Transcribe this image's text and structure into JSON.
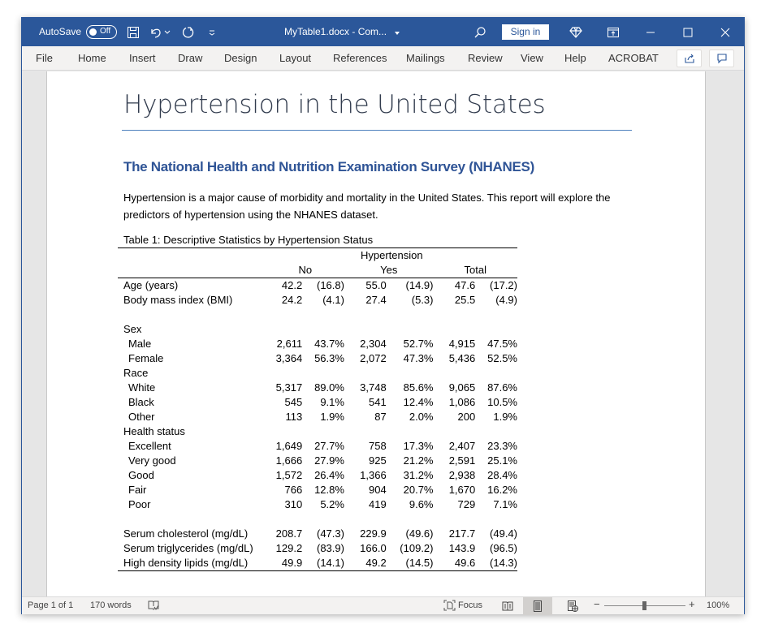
{
  "titlebar": {
    "autosave_label": "AutoSave",
    "autosave_state": "Off",
    "document_title": "MyTable1.docx  -  Com...",
    "sign_in_label": "Sign in",
    "icons": [
      "save-icon",
      "undo-icon",
      "redo-icon",
      "customize-qat-icon",
      "search-icon",
      "premium-diamond-icon",
      "ribbon-display-icon",
      "minimize-icon",
      "maximize-icon",
      "close-icon"
    ]
  },
  "ribbon": {
    "tabs": [
      "File",
      "Home",
      "Insert",
      "Draw",
      "Design",
      "Layout",
      "References",
      "Mailings",
      "Review",
      "View",
      "Help",
      "ACROBAT"
    ]
  },
  "document": {
    "title": "Hypertension in the United States",
    "subtitle": "The National Health and Nutrition Examination Survey (NHANES)",
    "paragraph": "Hypertension is a major cause of morbidity and mortality in the United States.  This report will explore the predictors of hypertension using the NHANES dataset.",
    "table": {
      "caption": "Table 1: Descriptive Statistics by Hypertension Status",
      "spanner": "Hypertension",
      "groups": [
        "No",
        "Yes",
        "Total"
      ],
      "rows": [
        {
          "label": "Age (years)",
          "indent": false,
          "values": [
            "42.2",
            "(16.8)",
            "55.0",
            "(14.9)",
            "47.6",
            "(17.2)"
          ]
        },
        {
          "label": "Body mass index (BMI)",
          "indent": false,
          "values": [
            "24.2",
            "(4.1)",
            "27.4",
            "(5.3)",
            "25.5",
            "(4.9)"
          ]
        },
        {
          "label": "",
          "indent": false,
          "values": [
            "",
            "",
            "",
            "",
            "",
            ""
          ]
        },
        {
          "label": "Sex",
          "indent": false,
          "values": [
            "",
            "",
            "",
            "",
            "",
            ""
          ]
        },
        {
          "label": "Male",
          "indent": true,
          "values": [
            "2,611",
            "43.7%",
            "2,304",
            "52.7%",
            "4,915",
            "47.5%"
          ]
        },
        {
          "label": "Female",
          "indent": true,
          "values": [
            "3,364",
            "56.3%",
            "2,072",
            "47.3%",
            "5,436",
            "52.5%"
          ]
        },
        {
          "label": "Race",
          "indent": false,
          "values": [
            "",
            "",
            "",
            "",
            "",
            ""
          ]
        },
        {
          "label": "White",
          "indent": true,
          "values": [
            "5,317",
            "89.0%",
            "3,748",
            "85.6%",
            "9,065",
            "87.6%"
          ]
        },
        {
          "label": "Black",
          "indent": true,
          "values": [
            "545",
            "9.1%",
            "541",
            "12.4%",
            "1,086",
            "10.5%"
          ]
        },
        {
          "label": "Other",
          "indent": true,
          "values": [
            "113",
            "1.9%",
            "87",
            "2.0%",
            "200",
            "1.9%"
          ]
        },
        {
          "label": "Health status",
          "indent": false,
          "values": [
            "",
            "",
            "",
            "",
            "",
            ""
          ]
        },
        {
          "label": "Excellent",
          "indent": true,
          "values": [
            "1,649",
            "27.7%",
            "758",
            "17.3%",
            "2,407",
            "23.3%"
          ]
        },
        {
          "label": "Very good",
          "indent": true,
          "values": [
            "1,666",
            "27.9%",
            "925",
            "21.2%",
            "2,591",
            "25.1%"
          ]
        },
        {
          "label": "Good",
          "indent": true,
          "values": [
            "1,572",
            "26.4%",
            "1,366",
            "31.2%",
            "2,938",
            "28.4%"
          ]
        },
        {
          "label": "Fair",
          "indent": true,
          "values": [
            "766",
            "12.8%",
            "904",
            "20.7%",
            "1,670",
            "16.2%"
          ]
        },
        {
          "label": "Poor",
          "indent": true,
          "values": [
            "310",
            "5.2%",
            "419",
            "9.6%",
            "729",
            "7.1%"
          ]
        },
        {
          "label": "",
          "indent": false,
          "values": [
            "",
            "",
            "",
            "",
            "",
            ""
          ]
        },
        {
          "label": "Serum cholesterol (mg/dL)",
          "indent": false,
          "values": [
            "208.7",
            "(47.3)",
            "229.9",
            "(49.6)",
            "217.7",
            "(49.4)"
          ]
        },
        {
          "label": "Serum triglycerides (mg/dL)",
          "indent": false,
          "values": [
            "129.2",
            "(83.9)",
            "166.0",
            "(109.2)",
            "143.9",
            "(96.5)"
          ]
        },
        {
          "label": "High density lipids (mg/dL)",
          "indent": false,
          "values": [
            "49.9",
            "(14.1)",
            "49.2",
            "(14.5)",
            "49.6",
            "(14.3)"
          ]
        }
      ]
    }
  },
  "statusbar": {
    "page": "Page 1 of 1",
    "words": "170 words",
    "focus_label": "Focus",
    "zoom_minus": "−",
    "zoom_plus": "+",
    "zoom_level": "100%",
    "zoom_fraction": 0.5
  }
}
